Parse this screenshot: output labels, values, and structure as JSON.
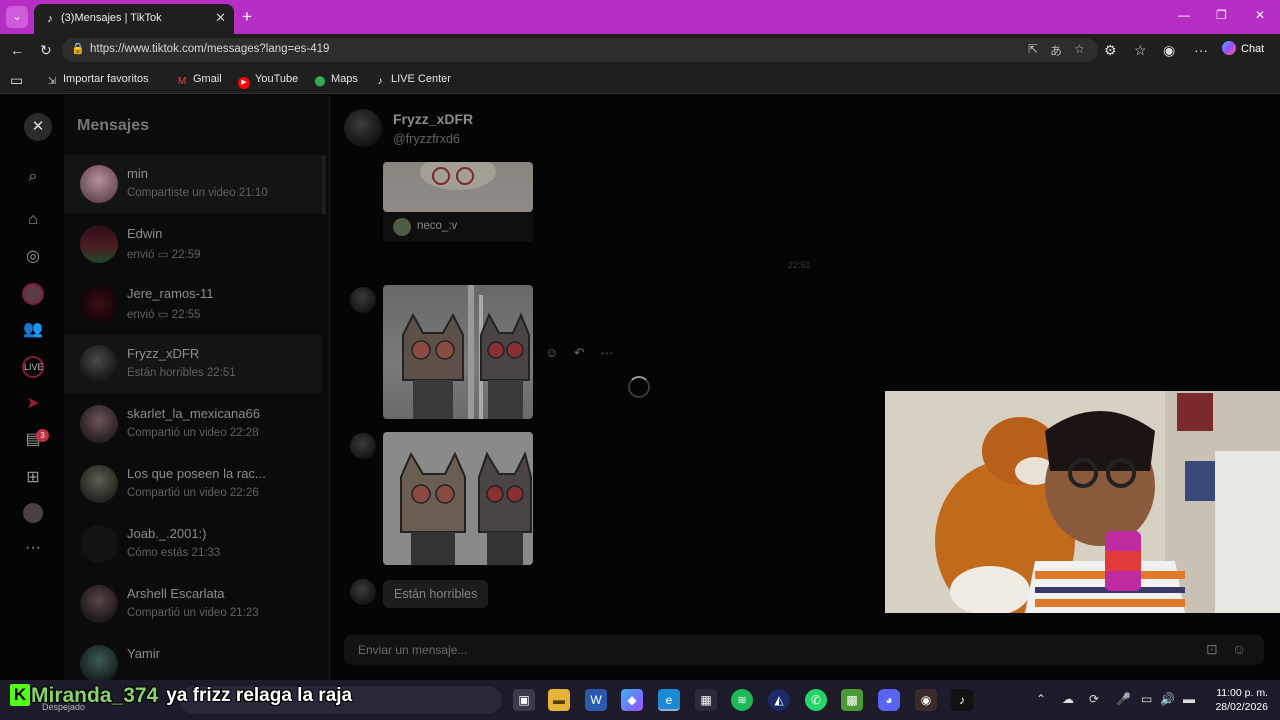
{
  "browser": {
    "tab_title": "(3)Mensajes | TikTok",
    "url": "https://www.tiktok.com/messages?lang=es-419",
    "chat_label": "Chat",
    "bookmarks": [
      "Importar favoritos",
      "Gmail",
      "YouTube",
      "Maps",
      "LIVE Center"
    ]
  },
  "sidebar": {
    "title": "Mensajes",
    "notif_count": "3",
    "conversations": [
      {
        "name": "min",
        "preview": "Compartiste un video 21:10",
        "avatar_color": "#6a4b55"
      },
      {
        "name": "Edwin",
        "preview": "envió ▭ 22:59",
        "avatar_color": "#3a1a1e"
      },
      {
        "name": "Jere_ramos-11",
        "preview": "envió ▭ 22:55",
        "avatar_color": "#2a0c0e"
      },
      {
        "name": "Fryzz_xDFR",
        "preview": "Están horribles 22:51",
        "avatar_color": "#2e2e2e"
      },
      {
        "name": "skarlet_la_mexicana66",
        "preview": "Compartió un video 22:28",
        "avatar_color": "#4a3b3b"
      },
      {
        "name": "Los que poseen la rac...",
        "preview": "Compartió un video 22:26",
        "avatar_color": "#3c4034"
      },
      {
        "name": "Joab._.2001:)",
        "preview": "Cómo estás 21:33",
        "avatar_color": "#151515"
      },
      {
        "name": "Arshell Escarlata",
        "preview": "Compartió un video 21:23",
        "avatar_color": "#3a2f2f"
      },
      {
        "name": "Yamir",
        "preview": "",
        "avatar_color": "#2f4a46"
      }
    ]
  },
  "chat": {
    "name": "Fryzz_xDFR",
    "handle": "@fryzzfrxd6",
    "shared_user": "neco_:v",
    "timestamp": "22:51",
    "last_message": "Están horribles",
    "input_placeholder": "Enviar un mensaje..."
  },
  "overlay": {
    "badge": "K",
    "username": "Miranda_374",
    "message": "ya frizz relaga la raja"
  },
  "taskbar": {
    "weather": "Despejado",
    "time": "11:00 p. m.",
    "date": "28/02/2026"
  },
  "colors": {
    "titlebar": "#b52fc4",
    "accent_red": "#fe2c55",
    "kick_green": "#53fc18"
  }
}
